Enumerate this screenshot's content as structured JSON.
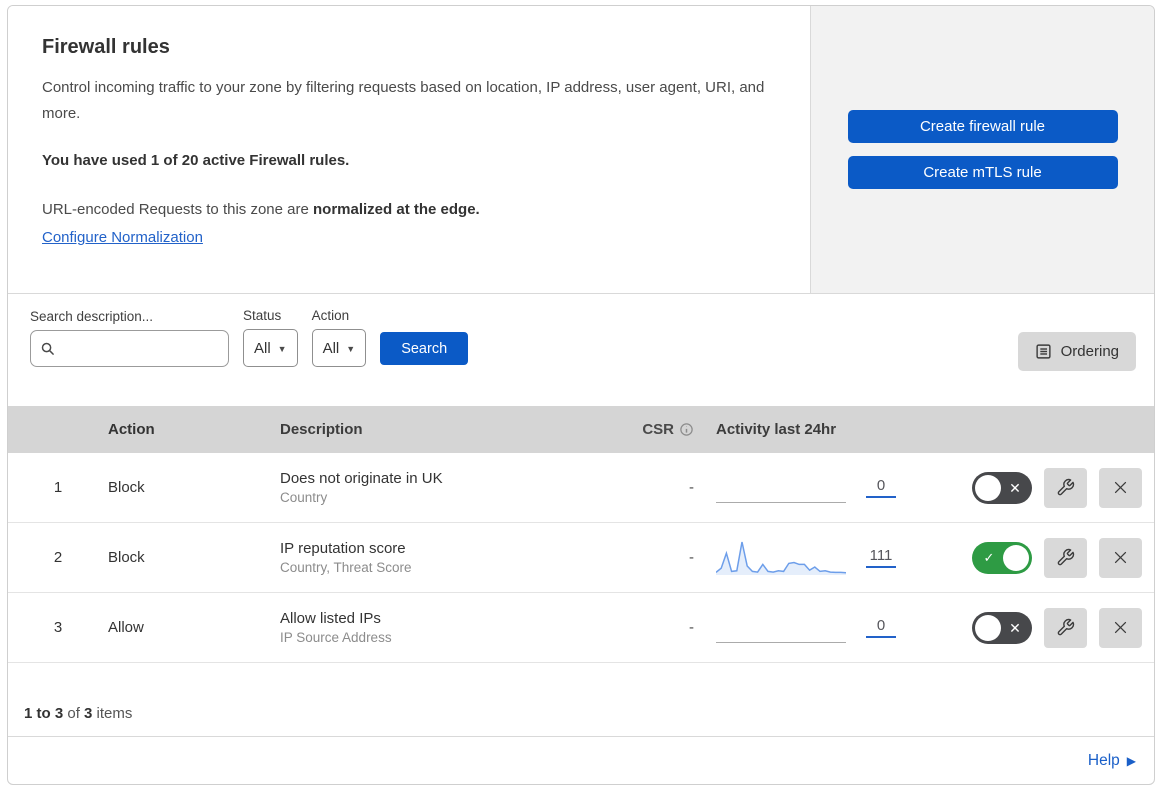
{
  "header": {
    "title": "Firewall rules",
    "description": "Control incoming traffic to your zone by filtering requests based on location, IP address, user agent, URI, and more.",
    "usage": "You have used 1 of 20 active Firewall rules.",
    "normalization_prefix": "URL-encoded Requests to this zone are ",
    "normalization_bold": "normalized at the edge.",
    "normalization_link": "Configure Normalization",
    "create_firewall_button": "Create firewall rule",
    "create_mtls_button": "Create mTLS rule"
  },
  "filters": {
    "search_label": "Search description...",
    "search_value": "",
    "status_label": "Status",
    "status_value": "All",
    "action_label": "Action",
    "action_value": "All",
    "search_button": "Search",
    "ordering_button": "Ordering"
  },
  "table": {
    "columns": {
      "action": "Action",
      "description": "Description",
      "csr": "CSR",
      "activity": "Activity last 24hr"
    },
    "rows": [
      {
        "index": "1",
        "action": "Block",
        "description": "Does not originate in UK",
        "criteria": "Country",
        "csr": "-",
        "activity_count": "0",
        "enabled": false,
        "sparkline": []
      },
      {
        "index": "2",
        "action": "Block",
        "description": "IP reputation score",
        "criteria": "Country, Threat Score",
        "csr": "-",
        "activity_count": "111",
        "enabled": true,
        "sparkline": [
          5,
          18,
          65,
          8,
          10,
          100,
          25,
          8,
          6,
          30,
          8,
          6,
          10,
          8,
          33,
          36,
          30,
          30,
          12,
          22,
          8,
          10,
          6,
          5,
          5,
          4
        ]
      },
      {
        "index": "3",
        "action": "Allow",
        "description": "Allow listed IPs",
        "criteria": "IP Source Address",
        "csr": "-",
        "activity_count": "0",
        "enabled": false,
        "sparkline": []
      }
    ]
  },
  "footer": {
    "count_bold_range": "1 to 3",
    "count_of": " of ",
    "count_total": "3",
    "count_items": " items",
    "help_label": "Help"
  },
  "colors": {
    "accent_blue": "#0b5ac6",
    "link_blue": "#2262c9",
    "toggle_on_green": "#2e9b44",
    "toggle_off_gray": "#47484b",
    "panel_gray": "#f2f2f2",
    "table_header_gray": "#d5d5d5",
    "sparkline_blue": "#6d9eea"
  }
}
